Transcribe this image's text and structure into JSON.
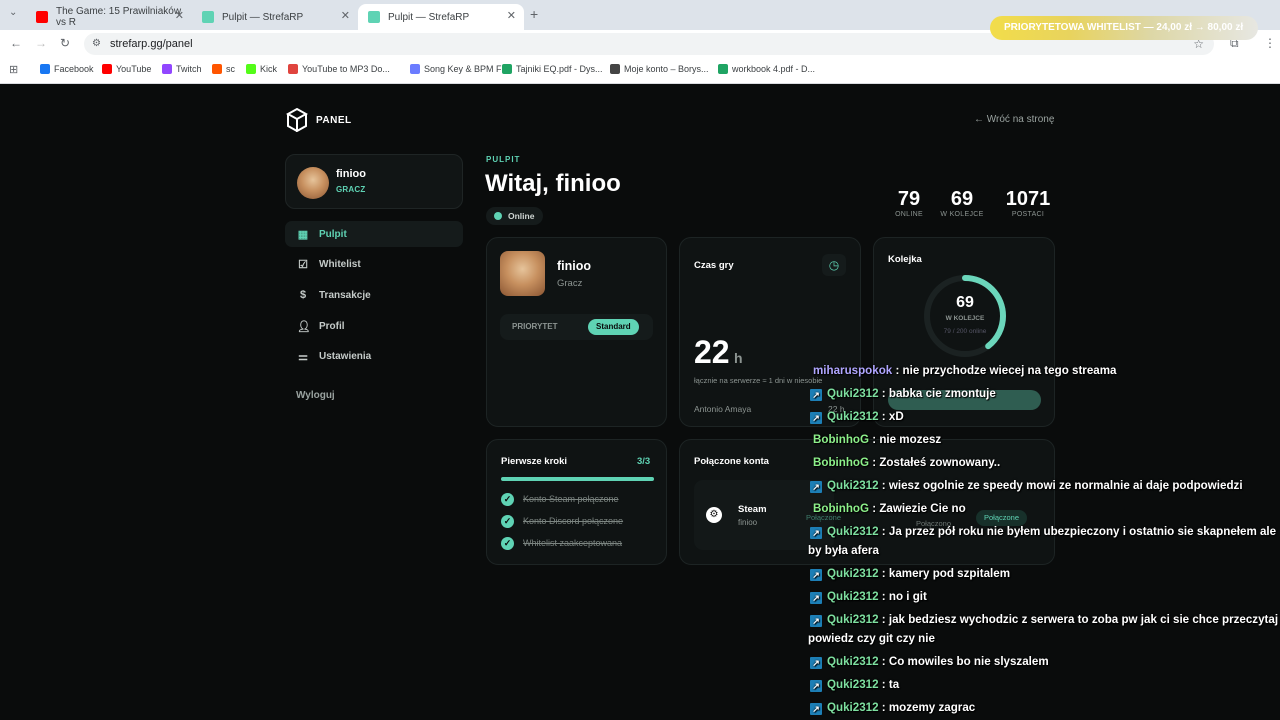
{
  "browser": {
    "tabs": [
      {
        "title": "The Game: 15 Prawilniaków vs R",
        "color": "#ff0000"
      },
      {
        "title": "Pulpit — StrefaRP",
        "color": "#5fd3b4"
      },
      {
        "title": "Pulpit — StrefaRP",
        "color": "#5fd3b4"
      }
    ],
    "new_tab": "+",
    "url": "strefarp.gg/panel",
    "bookmarks": [
      {
        "label": "Facebook",
        "color": "#1877f2"
      },
      {
        "label": "YouTube",
        "color": "#ff0000"
      },
      {
        "label": "Twitch",
        "color": "#9146ff"
      },
      {
        "label": "sc",
        "color": "#ff5500"
      },
      {
        "label": "Kick",
        "color": "#53fc18"
      },
      {
        "label": "YouTube to MP3 Do...",
        "color": "#e0443e"
      },
      {
        "label": "Song Key & BPM Fi...",
        "color": "#6b7cff"
      },
      {
        "label": "Tajniki EQ.pdf - Dys...",
        "color": "#1fa463"
      },
      {
        "label": "Moje konto – Borys...",
        "color": "#444444"
      },
      {
        "label": "workbook 4.pdf - D...",
        "color": "#1fa463"
      }
    ],
    "promo": "PRIORYTETOWA WHITELIST — 24,00 zł → 80,00 zł"
  },
  "brand": {
    "name": "PANEL"
  },
  "back_link": "← Wróć na stronę",
  "user": {
    "name": "finioo",
    "role": "GRACZ"
  },
  "nav": [
    {
      "label": "Pulpit",
      "icon": "grid-icon"
    },
    {
      "label": "Whitelist",
      "icon": "check-square-icon"
    },
    {
      "label": "Transakcje",
      "icon": "dollar-icon"
    },
    {
      "label": "Profil",
      "icon": "user-icon"
    },
    {
      "label": "Ustawienia",
      "icon": "sliders-icon"
    }
  ],
  "logout": "Wyloguj",
  "header": {
    "section": "PULPIT",
    "title": "Witaj, finioo",
    "status": "Online"
  },
  "stats": [
    {
      "value": "79",
      "label": "ONLINE"
    },
    {
      "value": "69",
      "label": "W KOLEJCE"
    },
    {
      "value": "1071",
      "label": "POSTACI"
    }
  ],
  "profile_card": {
    "name": "finioo",
    "role": "Gracz",
    "priority_label": "PRIORYTET",
    "priority_value": "Standard"
  },
  "playtime_card": {
    "title": "Czas gry",
    "value": "22",
    "unit": "h",
    "caption": "łącznie na serwerze ≈ 1 dni w niesobie",
    "character": "Antonio Amaya",
    "character_hours": "22 h"
  },
  "queue_card": {
    "title": "Kolejka",
    "value": "69",
    "label": "W KOLEJCE",
    "sub": "79 / 200 online",
    "progress": 0.395
  },
  "steps_card": {
    "title": "Pierwsze kroki",
    "count": "3/3",
    "items": [
      "Konto Steam połączone",
      "Konto Discord połączone",
      "Whitelist zaakceptowana"
    ]
  },
  "accounts_card": {
    "title": "Połączone konta",
    "service": "Steam",
    "account": "finioo",
    "status": "Połączone",
    "status2": "Połączono"
  },
  "chat": [
    {
      "user": "miharuspokok",
      "text": " : nie przychodze wiecej na tego streama",
      "badge": false,
      "color": "purple"
    },
    {
      "user": "Quki2312",
      "text": " : babka cie zmontuje",
      "badge": true,
      "color": "green"
    },
    {
      "user": "Quki2312",
      "text": " : xD",
      "badge": true,
      "color": "green"
    },
    {
      "user": "BobinhoG",
      "text": " : nie mozesz",
      "badge": false,
      "color": "lime"
    },
    {
      "user": "BobinhoG",
      "text": " : Zostałeś zownowany..",
      "badge": false,
      "color": "lime"
    },
    {
      "user": "Quki2312",
      "text": " : wiesz ogolnie ze speedy mowi ze normalnie ai daje podpowiedzi",
      "badge": true,
      "color": "green"
    },
    {
      "user": "BobinhoG",
      "text": " : Zawiezie Cie no",
      "badge": false,
      "color": "lime"
    },
    {
      "user": "Quki2312",
      "text": " : Ja przez pół roku nie byłem ubezpieczony i ostatnio sie skapnełem ale by była afera",
      "badge": true,
      "color": "green"
    },
    {
      "user": "Quki2312",
      "text": " : kamery pod szpitalem",
      "badge": true,
      "color": "green"
    },
    {
      "user": "Quki2312",
      "text": " : no i git",
      "badge": true,
      "color": "green"
    },
    {
      "user": "Quki2312",
      "text": " : jak bedziesz wychodzic z serwera to zoba pw jak ci sie chce przeczytaj powiedz czy git czy nie",
      "badge": true,
      "color": "green"
    },
    {
      "user": "Quki2312",
      "text": " : Co mowiles bo nie slyszalem",
      "badge": true,
      "color": "green"
    },
    {
      "user": "Quki2312",
      "text": " : ta",
      "badge": true,
      "color": "green"
    },
    {
      "user": "Quki2312",
      "text": " : mozemy zagrac",
      "badge": true,
      "color": "green"
    }
  ]
}
